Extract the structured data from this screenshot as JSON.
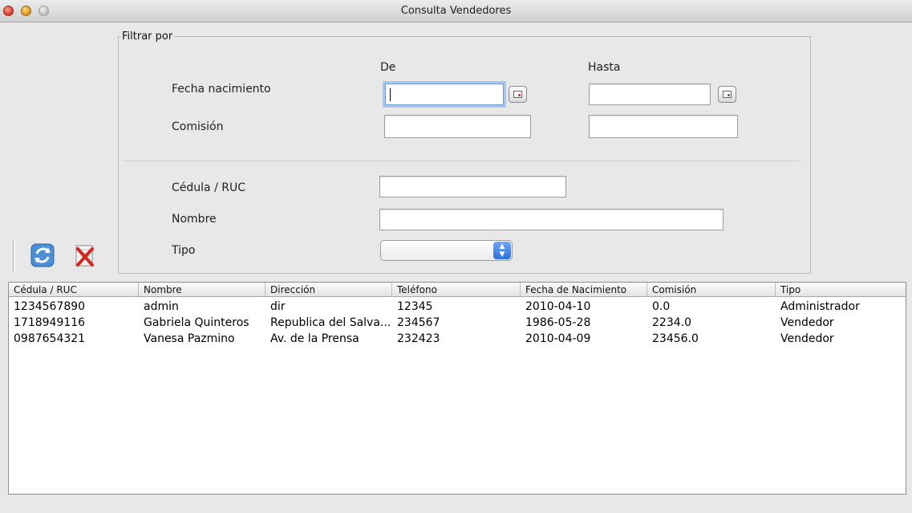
{
  "window": {
    "title": "Consulta Vendedores"
  },
  "filter": {
    "legend": "Filtrar por",
    "col_de": "De",
    "col_hasta": "Hasta",
    "fecha_label": "Fecha nacimiento",
    "comision_label": "Comisión",
    "cedula_label": "Cédula / RUC",
    "nombre_label": "Nombre",
    "tipo_label": "Tipo",
    "fecha_de_value": "",
    "fecha_hasta_value": "",
    "comision_de_value": "",
    "comision_hasta_value": "",
    "cedula_value": "",
    "nombre_value": "",
    "tipo_selected": ""
  },
  "toolbar": {
    "refresh_icon": "refresh-icon",
    "clear_icon": "clear-icon"
  },
  "table": {
    "headers": [
      "Cédula / RUC",
      "Nombre",
      "Dirección",
      "Teléfono",
      "Fecha de Nacimiento",
      "Comisión",
      "Tipo"
    ],
    "rows": [
      [
        "1234567890",
        "admin",
        "dir",
        "12345",
        "2010-04-10",
        "0.0",
        "Administrador"
      ],
      [
        "1718949116",
        "Gabriela Quinteros",
        "Republica del Salva...",
        "234567",
        "1986-05-28",
        "2234.0",
        "Vendedor"
      ],
      [
        "0987654321",
        "Vanesa Pazmino",
        "Av. de la Prensa",
        "232423",
        "2010-04-09",
        "23456.0",
        "Vendedor"
      ]
    ]
  }
}
